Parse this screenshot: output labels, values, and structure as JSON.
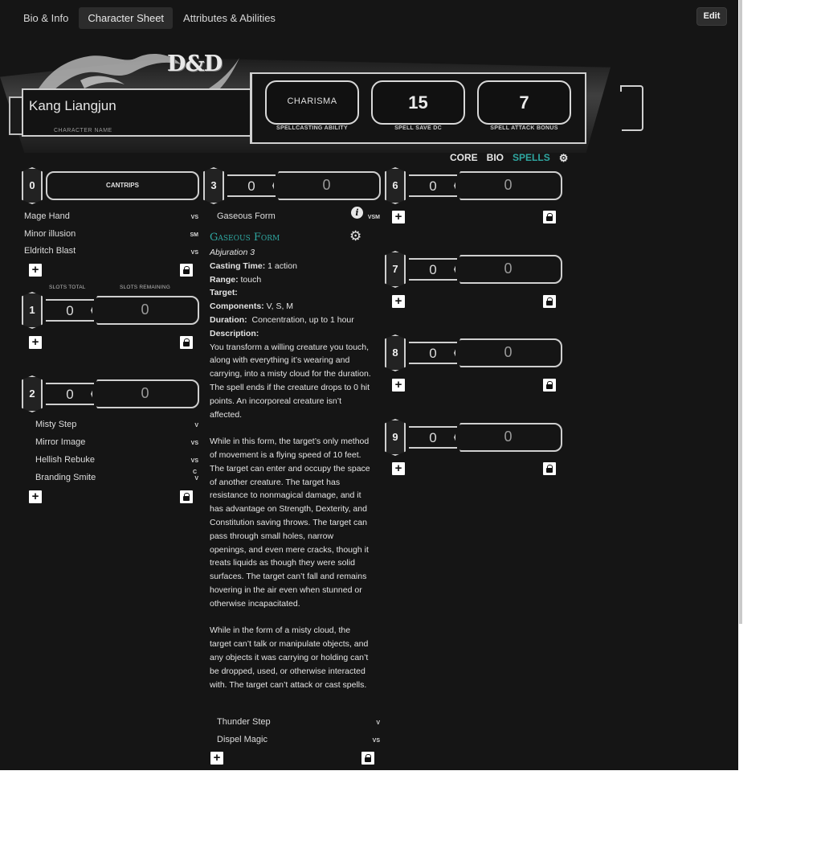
{
  "tabs": [
    "Bio & Info",
    "Character Sheet",
    "Attributes & Abilities"
  ],
  "edit_label": "Edit",
  "logo": "D&D",
  "character": {
    "name": "Kang Liangjun",
    "name_label": "CHARACTER NAME"
  },
  "stats": {
    "ability": "CHARISMA",
    "ability_label": "SPELLCASTING ABILITY",
    "dc": "15",
    "dc_label": "SPELL SAVE DC",
    "attack": "7",
    "attack_label": "SPELL ATTACK BONUS"
  },
  "subnav": [
    "CORE",
    "BIO",
    "SPELLS"
  ],
  "cantrips": {
    "level": "0",
    "label": "CANTRIPS",
    "spells": [
      {
        "name": "Mage Hand",
        "comp": "VS"
      },
      {
        "name": "Minor illusion",
        "comp": "SM"
      },
      {
        "name": "Eldritch Blast",
        "comp": "VS"
      }
    ]
  },
  "slot_labels": {
    "total": "SLOTS TOTAL",
    "remaining": "SLOTS REMAINING"
  },
  "level1": {
    "level": "1",
    "total": "0",
    "remaining": "0"
  },
  "level2": {
    "level": "2",
    "total": "0",
    "remaining": "0",
    "spells": [
      {
        "name": "Misty Step",
        "comp": "V"
      },
      {
        "name": "Mirror Image",
        "comp": "VS"
      },
      {
        "name": "Hellish Rebuke",
        "comp": "VS"
      },
      {
        "name": "Branding Smite",
        "comp_top": "C",
        "comp": "V"
      }
    ]
  },
  "level3": {
    "level": "3",
    "total": "0",
    "remaining": "0",
    "spells": [
      {
        "name": "Gaseous Form",
        "comp": "VSM"
      },
      {
        "name": "Thunder Step",
        "comp": "V"
      },
      {
        "name": "Dispel Magic",
        "comp": "VS"
      }
    ]
  },
  "detail": {
    "title": "Gaseous Form",
    "school": "Abjuration 3",
    "casting_time_label": "Casting Time:",
    "casting_time": "1 action",
    "range_label": "Range:",
    "range": "touch",
    "target_label": "Target:",
    "components_label": "Components:",
    "components": "V, S, M",
    "duration_label": "Duration:",
    "duration": "Concentration, up to 1 hour",
    "description_label": "Description:",
    "p1": "You transform a willing creature you touch, along with everything it’s wearing and carrying, into a misty cloud for the duration. The spell ends if the creature drops to 0 hit points. An incorporeal creature isn’t affected.",
    "p2": "While in this form, the target’s only method of movement is a flying speed of 10 feet. The target can enter and occupy the space of another creature. The target has resistance to nonmagical damage, and it has advantage on Strength, Dexterity, and Constitution saving throws. The target can pass through small holes, narrow openings, and even mere cracks, though it treats liquids as though they were solid surfaces. The target can’t fall and remains hovering in the air even when stunned or otherwise incapacitated.",
    "p3": "While in the form of a misty cloud, the target can’t talk or manipulate objects, and any objects it was carrying or holding can’t be dropped, used, or otherwise interacted with. The target can’t attack or cast spells."
  },
  "level6": {
    "level": "6",
    "total": "0",
    "remaining": "0"
  },
  "level7": {
    "level": "7",
    "total": "0",
    "remaining": "0"
  },
  "level8": {
    "level": "8",
    "total": "0",
    "remaining": "0"
  },
  "level9": {
    "level": "9",
    "total": "0",
    "remaining": "0"
  },
  "icons": {
    "add": "plus-icon",
    "lock": "lock-icon",
    "info": "info-icon",
    "settings": "gear-icon"
  }
}
